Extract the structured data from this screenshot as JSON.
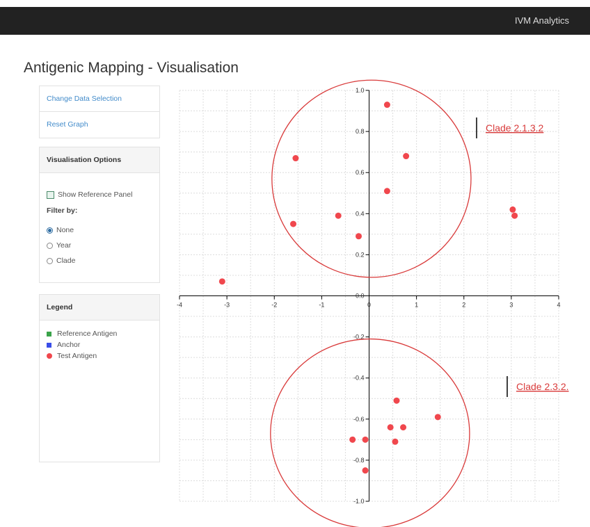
{
  "navbar": {
    "brand": "IVM Analytics"
  },
  "page": {
    "title": "Antigenic Mapping - Visualisation"
  },
  "sidebar": {
    "links": [
      "Change Data Selection",
      "Reset Graph"
    ],
    "options": {
      "heading": "Visualisation Options",
      "show_reference_panel": {
        "label": "Show Reference Panel",
        "checked": false
      },
      "filter_label": "Filter by:",
      "filters": [
        {
          "label": "None",
          "checked": true
        },
        {
          "label": "Year",
          "checked": false
        },
        {
          "label": "Clade",
          "checked": false
        }
      ]
    },
    "legend": {
      "heading": "Legend",
      "items": [
        {
          "label": "Reference Antigen",
          "color": "#3aa34a"
        },
        {
          "label": "Anchor",
          "color": "#3a4ee8"
        },
        {
          "label": "Test Antigen",
          "color": "#f0474d"
        }
      ]
    }
  },
  "chart_data": {
    "type": "scatter",
    "xlim": [
      -4,
      4
    ],
    "ylim": [
      -1.0,
      1.0
    ],
    "grid": true,
    "x_ticks": [
      "-4",
      "-3",
      "-2",
      "-1",
      "0",
      "1",
      "2",
      "3",
      "4"
    ],
    "y_ticks": [
      "1.0",
      "0.8",
      "0.6",
      "0.4",
      "0.2",
      "0.0",
      "-0.2",
      "-0.4",
      "-0.6",
      "-0.8",
      "-1.0"
    ],
    "point_color": "#f0474d",
    "points": [
      {
        "x": 0.38,
        "y": 0.93
      },
      {
        "x": 0.78,
        "y": 0.68
      },
      {
        "x": -1.55,
        "y": 0.67
      },
      {
        "x": 0.38,
        "y": 0.51
      },
      {
        "x": -0.65,
        "y": 0.39
      },
      {
        "x": -1.6,
        "y": 0.35
      },
      {
        "x": -0.22,
        "y": 0.29
      },
      {
        "x": -3.1,
        "y": 0.07
      },
      {
        "x": 3.03,
        "y": 0.42
      },
      {
        "x": 3.07,
        "y": 0.39
      },
      {
        "x": 0.58,
        "y": -0.51
      },
      {
        "x": 1.45,
        "y": -0.59
      },
      {
        "x": 0.45,
        "y": -0.64
      },
      {
        "x": 0.72,
        "y": -0.64
      },
      {
        "x": 0.55,
        "y": -0.71
      },
      {
        "x": -0.35,
        "y": -0.7
      },
      {
        "x": -0.08,
        "y": -0.7
      },
      {
        "x": -0.08,
        "y": -0.85
      }
    ],
    "annotations": [
      {
        "label": "Clade 2.1.3.2",
        "color": "#d93a3a",
        "cx": 0.05,
        "cy": 0.57,
        "rx": 2.1,
        "ry": 0.48
      },
      {
        "label": "Clade 2.3.2.",
        "color": "#d93a3a",
        "cx": 0.02,
        "cy": -0.67,
        "rx": 2.1,
        "ry": 0.46
      }
    ]
  }
}
